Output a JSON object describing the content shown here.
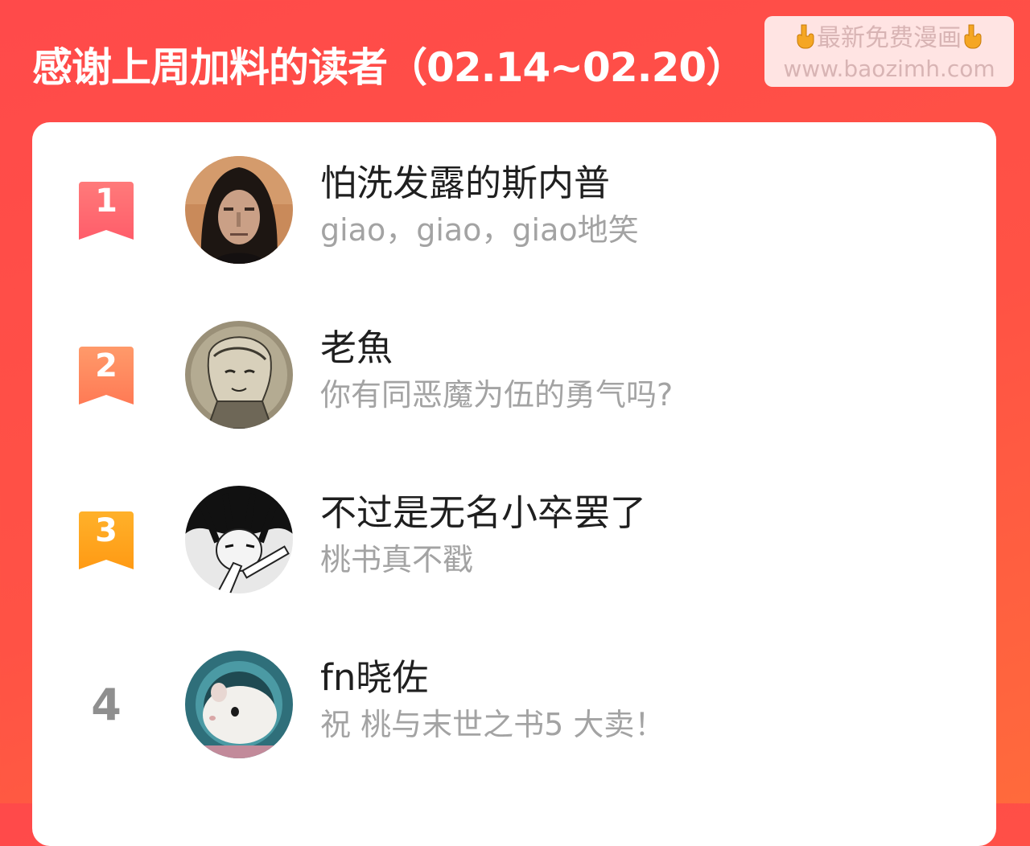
{
  "header": {
    "title": "感谢上周加料的读者（02.14~02.20）"
  },
  "watermark": {
    "line1": "最新免费漫画",
    "line2": "www.baozimh.com",
    "icon": "pointing-down-hand-icon"
  },
  "colors": {
    "background": "#ff4d47",
    "rank1": "#ff6a6a",
    "rank2": "#ff8a5a",
    "rank3": "#ffa21f",
    "rank_plain": "#8f8f8f",
    "name": "#1f1f1f",
    "message": "#a3a3a3"
  },
  "readers": [
    {
      "rank": "1",
      "name": "怕洗发露的斯内普",
      "message": "giao，giao，giao地笑",
      "avatar": "long-dark-hair-man-photo"
    },
    {
      "rank": "2",
      "name": "老魚",
      "message": "你有同恶魔为伍的勇气吗?",
      "avatar": "pencil-sketch-character"
    },
    {
      "rank": "3",
      "name": "不过是无名小卒罢了",
      "message": "桃书真不戳",
      "avatar": "manga-boy-black-white"
    },
    {
      "rank": "4",
      "name": "fn晓佐",
      "message": "祝 桃与末世之书5 大卖！",
      "avatar": "white-hamster-photo"
    }
  ]
}
